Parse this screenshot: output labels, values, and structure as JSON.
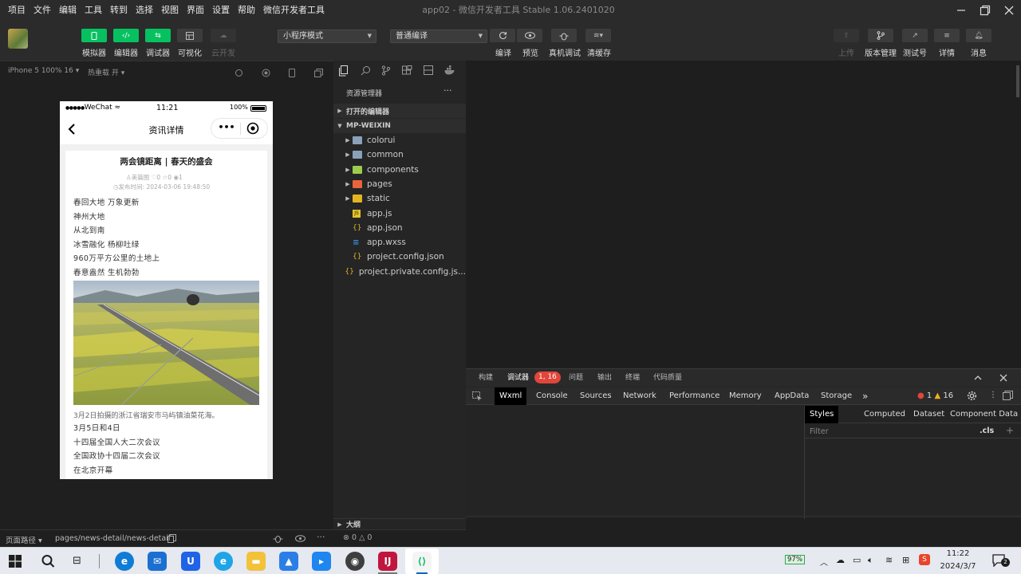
{
  "menubar": {
    "items": [
      "项目",
      "文件",
      "编辑",
      "工具",
      "转到",
      "选择",
      "视图",
      "界面",
      "设置",
      "帮助",
      "微信开发者工具"
    ]
  },
  "window_title": "app02 - 微信开发者工具 Stable 1.06.2401020",
  "toolbar": {
    "simulator": "模拟器",
    "editor": "编辑器",
    "debugger": "调试器",
    "visual": "可视化",
    "cloud": "云开发",
    "mode_select": "小程序模式",
    "compile_select": "普通编译",
    "compile": "编译",
    "preview": "预览",
    "device_debug": "真机调试",
    "clear_cache": "清缓存",
    "upload": "上传",
    "version": "版本管理",
    "test": "测试号",
    "details": "详情",
    "messages": "消息"
  },
  "simbar": {
    "device": "iPhone 5 100% 16",
    "hot_reload": "热重载 开"
  },
  "phone": {
    "status_dots": "●●●●●",
    "carrier": "WeChat",
    "time": "11:21",
    "battery": "100%",
    "nav_title": "资讯详情",
    "capsule_more": "•••",
    "article": {
      "title": "两会镜距离 | 春天的盛会",
      "author": "美篇图",
      "likes": "0",
      "stars": "0",
      "views": "1",
      "publish": "发布时间: 2024-03-06 19:48:50",
      "paragraphs": [
        "春回大地 万象更新",
        "神州大地",
        "从北到南",
        "冰雪融化 杨柳吐绿",
        "960万平方公里的土地上",
        "春意盎然 生机勃勃"
      ],
      "caption": "3月2日拍摄的浙江省瑞安市马屿镇油菜花海。",
      "paragraphs2": [
        "3月5日和4日",
        "十四届全国人大二次会议",
        "全国政协十四届二次会议",
        "在北京开幕"
      ]
    }
  },
  "explorer": {
    "title": "资源管理器",
    "more": "···",
    "open_editors": "打开的编辑器",
    "root": "MP-WEIXIN",
    "items": [
      {
        "name": "colorui",
        "type": "folder"
      },
      {
        "name": "common",
        "type": "folder"
      },
      {
        "name": "components",
        "type": "folder"
      },
      {
        "name": "pages",
        "type": "folder"
      },
      {
        "name": "static",
        "type": "folder"
      },
      {
        "name": "app.js",
        "type": "js"
      },
      {
        "name": "app.json",
        "type": "json"
      },
      {
        "name": "app.wxss",
        "type": "wxss"
      },
      {
        "name": "project.config.json",
        "type": "json"
      },
      {
        "name": "project.private.config.js...",
        "type": "json"
      }
    ],
    "outline": "大纲",
    "errors": "0",
    "warnings": "0"
  },
  "devtools": {
    "top_tabs": [
      "构建",
      "调试器",
      "问题",
      "输出",
      "终端",
      "代码质量"
    ],
    "badge": "1, 16",
    "tabs": [
      "Wxml",
      "Console",
      "Sources",
      "Network",
      "Performance",
      "Memory",
      "AppData",
      "Storage"
    ],
    "more": "»",
    "error_count": "1",
    "warning_count": "16",
    "side_tabs": [
      "Styles",
      "Computed",
      "Dataset",
      "Component Data"
    ],
    "filter": "Filter",
    "cls": ".cls",
    "plus": "+"
  },
  "statusbar": {
    "path_label": "页面路径",
    "path": "pages/news-detail/news-detail"
  },
  "taskbar": {
    "battery": "97%",
    "time": "11:22",
    "date": "2024/3/7",
    "notif": "2"
  },
  "colors": {
    "green": "#07c160",
    "bg": "#1f1f1f",
    "badge": "#e0463a"
  }
}
